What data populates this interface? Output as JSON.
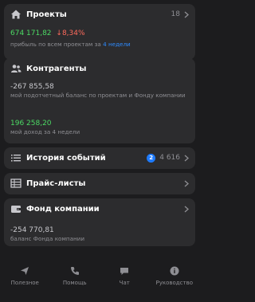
{
  "projects": {
    "title": "Проекты",
    "count": "18",
    "amount": "674 171,82",
    "change": "↓8,34%",
    "caption_prefix": "прибыль по всем проектам за ",
    "caption_link": "4 недели"
  },
  "contractors": {
    "title": "Контрагенты",
    "balance": "-267 855,58",
    "balance_caption": "мой подотчетный баланс по проектам и Фонду компании",
    "income": "196 258,20",
    "income_caption": "мой доход за 4 недели"
  },
  "events": {
    "title": "История событий",
    "badge": "2",
    "count": "4 616"
  },
  "prices": {
    "title": "Прайс-листы"
  },
  "fund": {
    "title": "Фонд компании",
    "balance": "-254 770,81",
    "caption": "баланс Фонда компании"
  },
  "tabs": [
    {
      "label": "Полезное",
      "icon": "send-icon"
    },
    {
      "label": "Помощь",
      "icon": "phone-icon"
    },
    {
      "label": "Чат",
      "icon": "chat-icon"
    },
    {
      "label": "Руководство",
      "icon": "info-icon"
    }
  ],
  "colors": {
    "background": "#1c1c1e",
    "card": "#2c2c2e",
    "positive": "#4cd964",
    "negative": "#ff6b5c",
    "accent": "#2e8bff"
  }
}
